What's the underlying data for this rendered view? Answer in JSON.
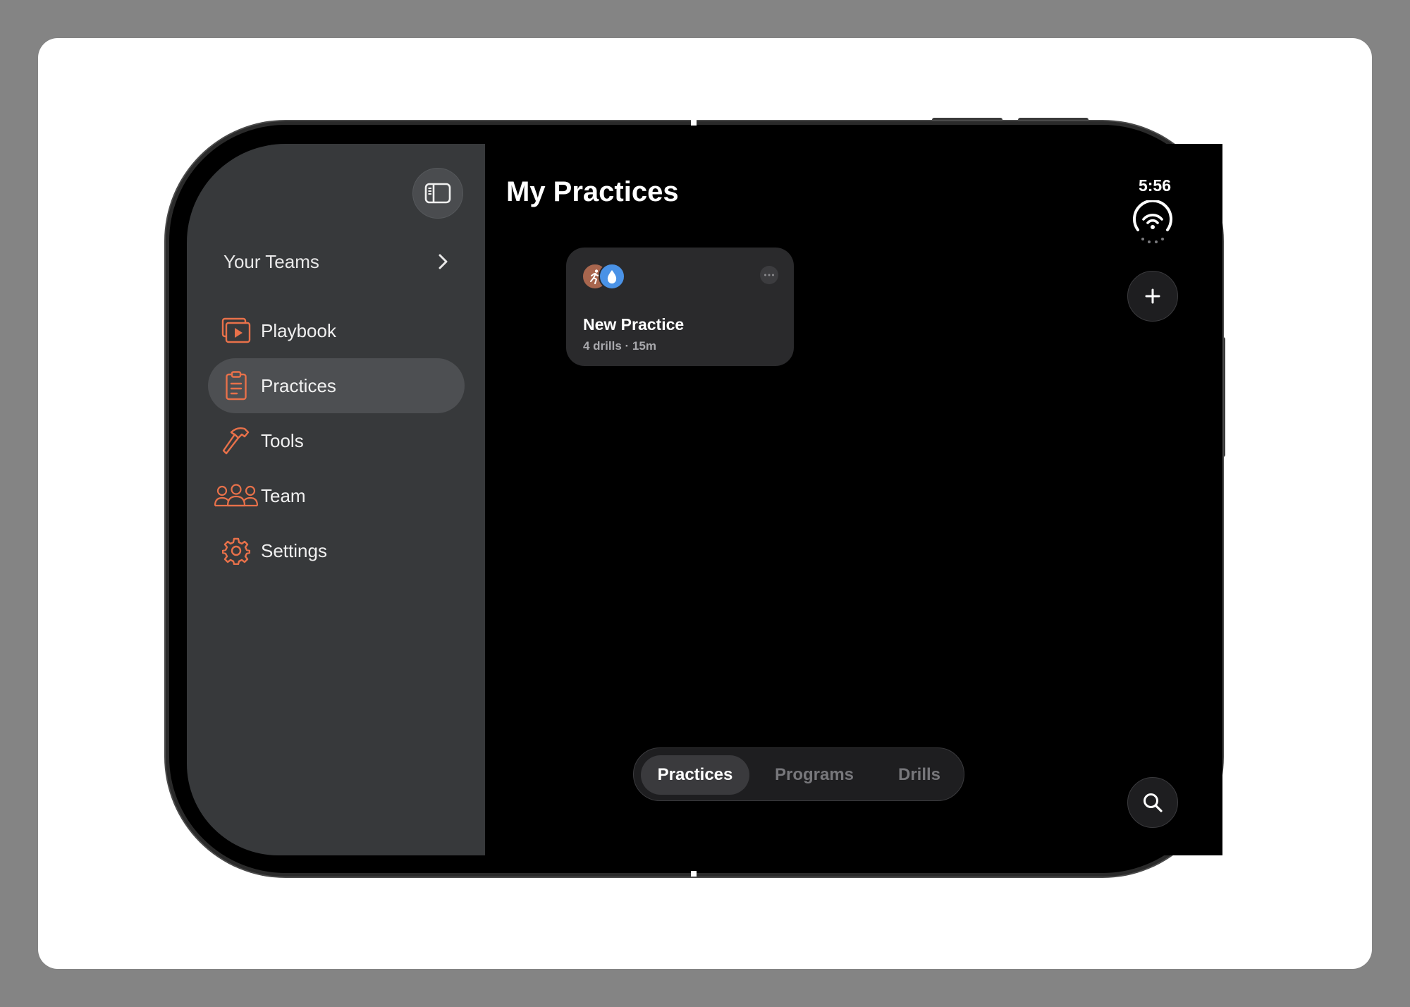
{
  "sidebar": {
    "your_teams_label": "Your Teams",
    "items": [
      {
        "label": "Playbook",
        "icon": "playbook-icon",
        "active": false
      },
      {
        "label": "Practices",
        "icon": "clipboard-icon",
        "active": true
      },
      {
        "label": "Tools",
        "icon": "hammer-icon",
        "active": false
      },
      {
        "label": "Team",
        "icon": "people-icon",
        "active": false
      },
      {
        "label": "Settings",
        "icon": "gear-icon",
        "active": false
      }
    ]
  },
  "main": {
    "title": "My Practices",
    "practice_card": {
      "title": "New Practice",
      "meta": "4 drills · 15m",
      "icons": [
        "running-icon",
        "water-drop-icon"
      ]
    }
  },
  "status": {
    "time": "5:56"
  },
  "segmented": {
    "tabs": [
      {
        "label": "Practices",
        "active": true
      },
      {
        "label": "Programs",
        "active": false
      },
      {
        "label": "Drills",
        "active": false
      }
    ]
  },
  "colors": {
    "accent": "#e8714a",
    "sidebar_bg": "#37393b",
    "sidebar_active": "#4d4f52",
    "card_bg": "#2a2a2c",
    "run_badge": "#a8664e",
    "drop_badge": "#4a92e6"
  }
}
